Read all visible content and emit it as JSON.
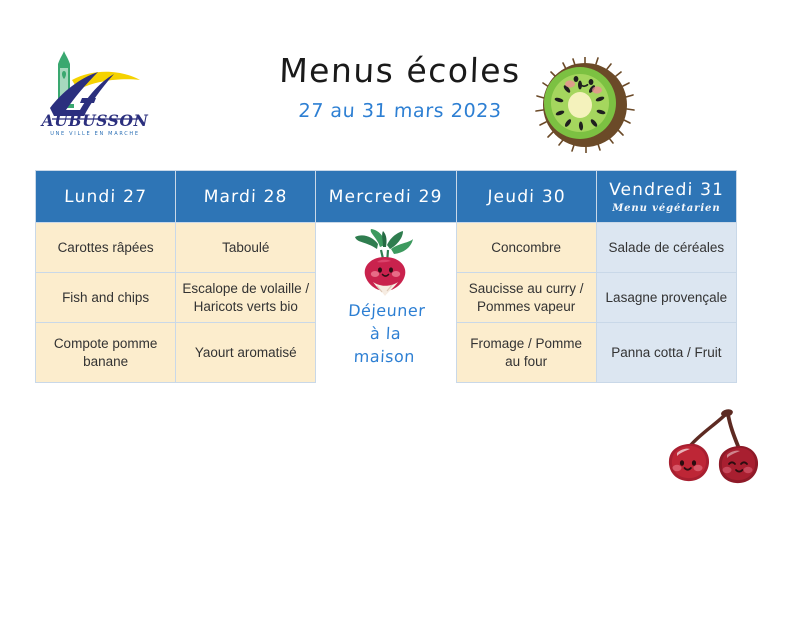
{
  "header": {
    "logo": {
      "name": "AUBUSSON",
      "tagline": "UNE VILLE EN MARCHE"
    },
    "title": "Menus écoles",
    "subtitle": "27 au 31 mars 2023",
    "decoration_icon": "kiwi-fruit-icon"
  },
  "table": {
    "columns": [
      {
        "day": "Lundi 27",
        "note": ""
      },
      {
        "day": "Mardi 28",
        "note": ""
      },
      {
        "day": "Mercredi 29",
        "note": ""
      },
      {
        "day": "Jeudi 30",
        "note": ""
      },
      {
        "day": "Vendredi 31",
        "note": "Menu végétarien"
      }
    ],
    "rows": [
      {
        "lundi": "Carottes râpées",
        "mardi": "Taboulé",
        "jeudi": "Concombre",
        "vendredi": "Salade de céréales"
      },
      {
        "lundi": "Fish and chips",
        "mardi": "Escalope de volaille / Haricots verts bio",
        "jeudi": "Saucisse au curry / Pommes vapeur",
        "vendredi": "Lasagne provençale"
      },
      {
        "lundi": "Compote pomme banane",
        "mardi": "Yaourt aromatisé",
        "jeudi": "Fromage / Pomme au four",
        "vendredi": "Panna cotta / Fruit"
      }
    ],
    "merged_cell": {
      "text_line1": "Déjeuner",
      "text_line2": "à la",
      "text_line3": "maison",
      "icon": "radish-icon"
    }
  },
  "footer_decoration": {
    "icon": "cherries-icon"
  },
  "colors": {
    "header_blue": "#2e75b6",
    "cream": "#fcedcd",
    "light_blue": "#dce6f1",
    "accent_blue": "#2d7fd3",
    "border": "#c9d8e8"
  }
}
